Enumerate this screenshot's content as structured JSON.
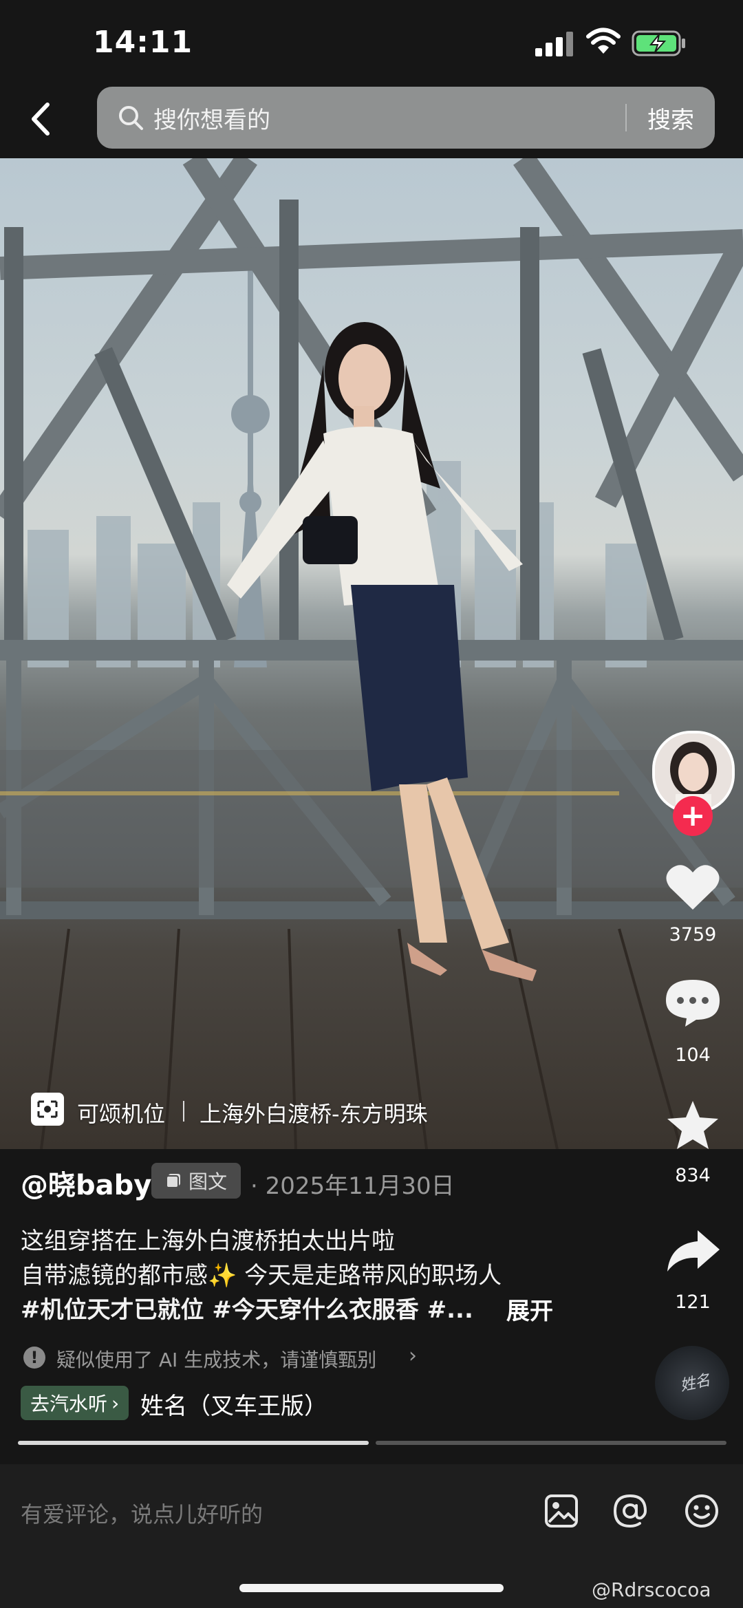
{
  "status": {
    "time": "14:11"
  },
  "header": {
    "search_placeholder": "搜你想看的",
    "search_button": "搜索"
  },
  "location": {
    "label": "可颂机位",
    "place": "上海外白渡桥-东方明珠"
  },
  "actions": {
    "likes": "3759",
    "comments": "104",
    "favorites": "834",
    "shares": "121"
  },
  "post": {
    "author": "@晓baby",
    "type_badge": "图文",
    "date": "· 2025年11月30日",
    "lines": [
      "这组穿搭在上海外白渡桥拍太出片啦",
      "自带滤镜的都市感✨ 今天是走路带风的职场人",
      "#机位天才已就位 #今天穿什么衣服香 #..."
    ],
    "expand": "展开",
    "ai_notice": "疑似使用了 AI 生成技术，请谨慎甄别",
    "music_tag": "去汽水听",
    "music_title": "姓名（叉车王版）",
    "disc_text": "姓名"
  },
  "progress": {
    "slides": 2,
    "current": 1
  },
  "comment": {
    "placeholder": "有爱评论，说点儿好听的"
  },
  "icons": [
    "back-icon",
    "search-icon",
    "location-icon",
    "heart-icon",
    "comment-icon",
    "star-icon",
    "share-icon",
    "image-icon",
    "at-icon",
    "emoji-icon"
  ],
  "colors": {
    "follow": "#f42b4f",
    "music_tag": "#3a5a44",
    "search_bg": "#8f9191",
    "battery": "#5ee27a"
  },
  "watermark": "@Rdrscocoa"
}
